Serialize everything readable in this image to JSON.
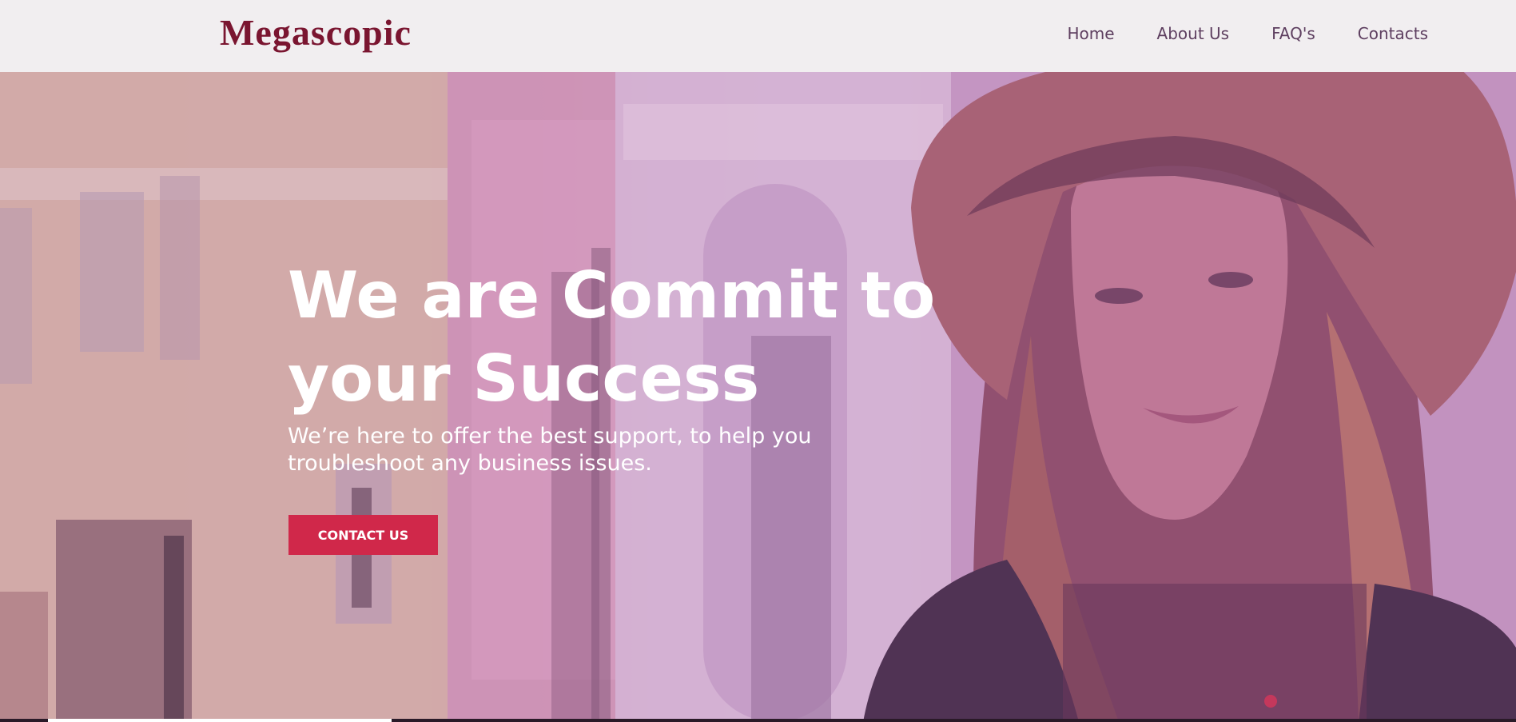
{
  "brand": {
    "name": "Megascopic"
  },
  "nav": {
    "items": [
      {
        "label": "Home"
      },
      {
        "label": "About Us"
      },
      {
        "label": "FAQ's"
      },
      {
        "label": "Contacts"
      }
    ]
  },
  "hero": {
    "headline_line1": "We are Commit to",
    "headline_line2": "your Success",
    "subtext_line1": "We’re here to offer the best support, to help you",
    "subtext_line2": "troubleshoot any business issues.",
    "cta_label": "CONTACT US"
  },
  "colors": {
    "brand": "#7a1530",
    "nav_text": "#5e3f60",
    "navbar_bg": "#f1eef0",
    "cta_bg": "#d0284a"
  },
  "icons": {
    "hero_image": "woman-in-hat-photo"
  }
}
